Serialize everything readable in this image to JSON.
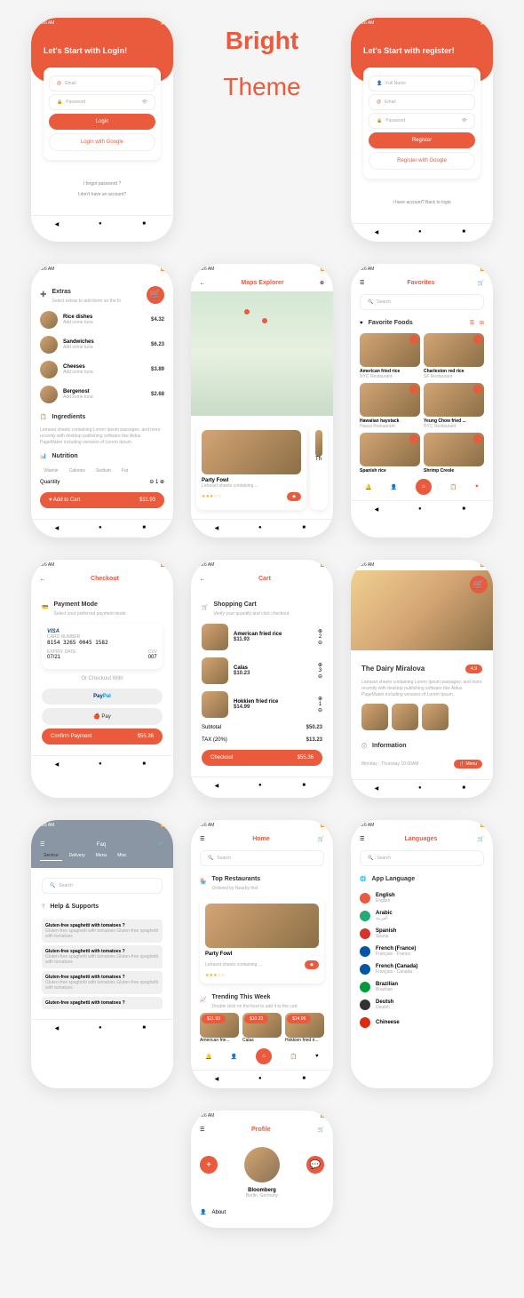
{
  "theme_title_1": "Bright",
  "theme_title_2": "Theme",
  "status_time": "2:26 AM",
  "login": {
    "title": "Let's Start with Login!",
    "email": "Email",
    "pwd": "Password",
    "btn": "Login",
    "google": "Login with Google",
    "forgot": "I forgot password ?",
    "noacc": "I don't have an account?"
  },
  "register": {
    "title": "Let's Start with register!",
    "name": "Full Name",
    "email": "Email",
    "pwd": "Password",
    "btn": "Register",
    "google": "Register with Google",
    "have": "I have account? Back to login"
  },
  "maps": {
    "title": "Maps Explorer",
    "card_title": "Party Fowl",
    "card_sub": "Letraset sheets containing ...",
    "next": "Th"
  },
  "extras": {
    "title": "Extras",
    "sub": "Select extras to add them on the fo",
    "items": [
      {
        "name": "Rice dishes",
        "sub": "Add some tuna",
        "price": "$4.32"
      },
      {
        "name": "Sandwiches",
        "sub": "Add some tuna",
        "price": "$6.23"
      },
      {
        "name": "Cheeses",
        "sub": "Add some tuna",
        "price": "$3.89"
      },
      {
        "name": "Bergenost",
        "sub": "Add some tuna",
        "price": "$2.68"
      }
    ],
    "ing": "Ingredients",
    "ing_desc": "Letraset sheets containing Lorem Ipsum passages, and more recently with desktop publishing software like Aldus PageMaker including versions of Lorem Ipsum.",
    "nut": "Nutrition",
    "nut_tabs": [
      "Vitamin",
      "Calories",
      "Sodium",
      "Fat"
    ],
    "qty": "Quantity",
    "qty_val": "1",
    "add": "Add to Cart",
    "price": "$11.93"
  },
  "cart": {
    "title": "Cart",
    "shop": "Shopping Cart",
    "sub": "Verify your quantity and click checkout",
    "items": [
      {
        "name": "American fried rice",
        "price": "$11.93",
        "qty": "2"
      },
      {
        "name": "Calas",
        "price": "$10.23",
        "qty": "3"
      },
      {
        "name": "Hokkien fried rice",
        "price": "$14.99",
        "qty": "1"
      }
    ],
    "subtotal_l": "Subtotal",
    "subtotal": "$50.23",
    "tax_l": "TAX (20%)",
    "tax": "$13.23",
    "checkout": "Checkout",
    "total": "$55.36"
  },
  "favorites": {
    "title": "Favorites",
    "search": "Search",
    "section": "Favorite Foods",
    "items": [
      {
        "name": "American fried rice",
        "sub": "NYC Restaurant"
      },
      {
        "name": "Charleston red rice",
        "sub": "SF Restaurant"
      },
      {
        "name": "Hawaiian haystack",
        "sub": "Hawai Restaurant"
      },
      {
        "name": "Yeung Chow fried ...",
        "sub": "NYC Restaurant"
      },
      {
        "name": "Spanish rice",
        "sub": ""
      },
      {
        "name": "Shrimp Creole",
        "sub": ""
      }
    ]
  },
  "checkout": {
    "title": "Checkout",
    "mode": "Payment Mode",
    "mode_sub": "Select your preferred payment mode",
    "visa": "VISA",
    "card_l": "CARD NUMBER",
    "card": "8154   3265   0045   1582",
    "exp_l": "EXPIRY DATE",
    "exp": "07/21",
    "cvv_l": "CVV",
    "cvv": "007",
    "or": "Or Checkout With",
    "paypal": "PayPal",
    "apple": "🍎 Pay",
    "confirm": "Confirm Payment",
    "total": "$55.36"
  },
  "home": {
    "title": "Home",
    "search": "Search",
    "top": "Top Restaurants",
    "top_sub": "Ordered by Nearby first",
    "card_title": "Party Fowl",
    "card_sub": "Letraset sheets containing ...",
    "trending": "Trending This Week",
    "trending_sub": "Double click on the food to add it to the cart",
    "items": [
      {
        "price": "$11.93",
        "name": "American frie..."
      },
      {
        "price": "$10.23",
        "name": "Calas"
      },
      {
        "price": "$14.99",
        "name": "Hokkien fried ri..."
      }
    ]
  },
  "resto": {
    "name": "The Dairy Miralova",
    "rating": "4.9",
    "desc": "Letraset sheets containing Lorem Ipsum passages, and more recently with desktop publishing software like Aldus PageMaker including versions of Lorem Ipsum.",
    "info": "Information",
    "hours": "Monday - Thursday   10:00AM -",
    "menu": "Menu"
  },
  "faq": {
    "title": "Faq",
    "tabs": [
      "Service",
      "Delivery",
      "Menu",
      "Misc"
    ],
    "search": "Search",
    "help": "Help & Supports",
    "q": "Gluten-free spaghetti with tomatoes ?",
    "a": "Gluten-free spaghetti with tomatoes Gluten-free spaghetti with tomatoes"
  },
  "profile": {
    "title": "Profile",
    "name": "Bloomberg",
    "loc": "Berlin, Germany",
    "about": "About"
  },
  "lang": {
    "title": "Languages",
    "search": "Search",
    "section": "App Language",
    "items": [
      {
        "name": "English",
        "sub": "English"
      },
      {
        "name": "Arabic",
        "sub": "العربية"
      },
      {
        "name": "Spanish",
        "sub": "Spana"
      },
      {
        "name": "French (France)",
        "sub": "Français - France"
      },
      {
        "name": "French (Canada)",
        "sub": "Français - Canada"
      },
      {
        "name": "Brazilian",
        "sub": "Brazilian"
      },
      {
        "name": "Deutsh",
        "sub": "Deutsh"
      },
      {
        "name": "Chineese",
        "sub": ""
      }
    ]
  }
}
